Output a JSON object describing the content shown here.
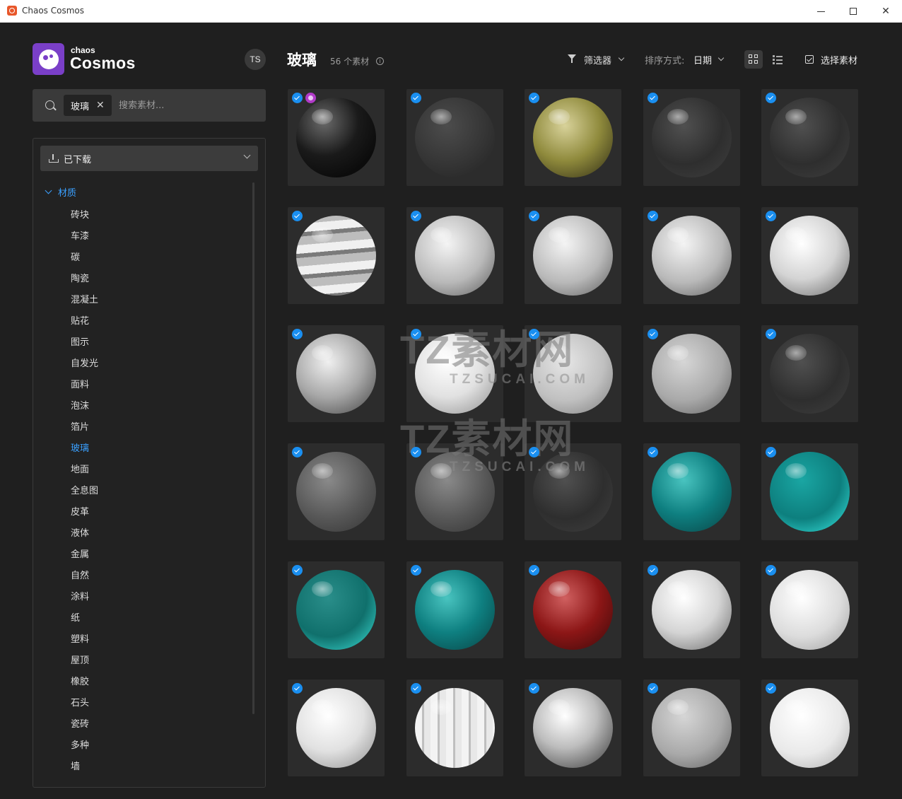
{
  "window": {
    "title": "Chaos Cosmos"
  },
  "brand": {
    "small": "chaos",
    "big": "Cosmos"
  },
  "user": {
    "initials": "TS"
  },
  "search": {
    "chip": "玻璃",
    "placeholder": "搜索素材..."
  },
  "sidebar": {
    "filter": "已下载",
    "category_group": "材质",
    "categories": [
      "砖块",
      "车漆",
      "碳",
      "陶瓷",
      "混凝土",
      "贴花",
      "图示",
      "自发光",
      "面料",
      "泡沫",
      "箔片",
      "玻璃",
      "地面",
      "全息图",
      "皮革",
      "液体",
      "金属",
      "自然",
      "涂料",
      "纸",
      "塑料",
      "屋顶",
      "橡胶",
      "石头",
      "瓷砖",
      "多种",
      "墙"
    ],
    "active_category": "玻璃"
  },
  "header": {
    "title": "玻璃",
    "count": "56 个素材",
    "filter_label": "筛选器",
    "sort_label": "排序方式:",
    "sort_value": "日期",
    "select_label": "选择素材"
  },
  "assets": [
    {
      "style": "dark-patterned",
      "checked": true,
      "badge": true
    },
    {
      "style": "frosted-dark",
      "checked": true
    },
    {
      "style": "amber",
      "checked": true
    },
    {
      "style": "clear-dark",
      "checked": true
    },
    {
      "style": "clear-dark",
      "checked": true
    },
    {
      "style": "striped",
      "checked": true
    },
    {
      "style": "textured-light",
      "checked": true
    },
    {
      "style": "textured-light",
      "checked": true
    },
    {
      "style": "textured-light",
      "checked": true
    },
    {
      "style": "bright-clear",
      "checked": true
    },
    {
      "style": "hammered",
      "checked": true
    },
    {
      "style": "white-frosted",
      "checked": true
    },
    {
      "style": "hex-pattern",
      "checked": true
    },
    {
      "style": "frosted-light",
      "checked": true
    },
    {
      "style": "clear-dark",
      "checked": true
    },
    {
      "style": "smoky",
      "checked": true
    },
    {
      "style": "smoky",
      "checked": true
    },
    {
      "style": "clear-dark",
      "checked": true
    },
    {
      "style": "teal-clear",
      "checked": true
    },
    {
      "style": "teal",
      "checked": true
    },
    {
      "style": "teal-frosted",
      "checked": true
    },
    {
      "style": "teal-clear",
      "checked": true
    },
    {
      "style": "red",
      "checked": true
    },
    {
      "style": "bright-clear",
      "checked": true
    },
    {
      "style": "crackle",
      "checked": true
    },
    {
      "style": "white-frosted",
      "checked": true
    },
    {
      "style": "bamboo",
      "checked": true
    },
    {
      "style": "chrome-clear",
      "checked": true
    },
    {
      "style": "frosted-light",
      "checked": true
    },
    {
      "style": "white",
      "checked": true
    }
  ],
  "watermark": {
    "line1": "TZ素材网",
    "line2": "TZSUCAI.COM"
  }
}
